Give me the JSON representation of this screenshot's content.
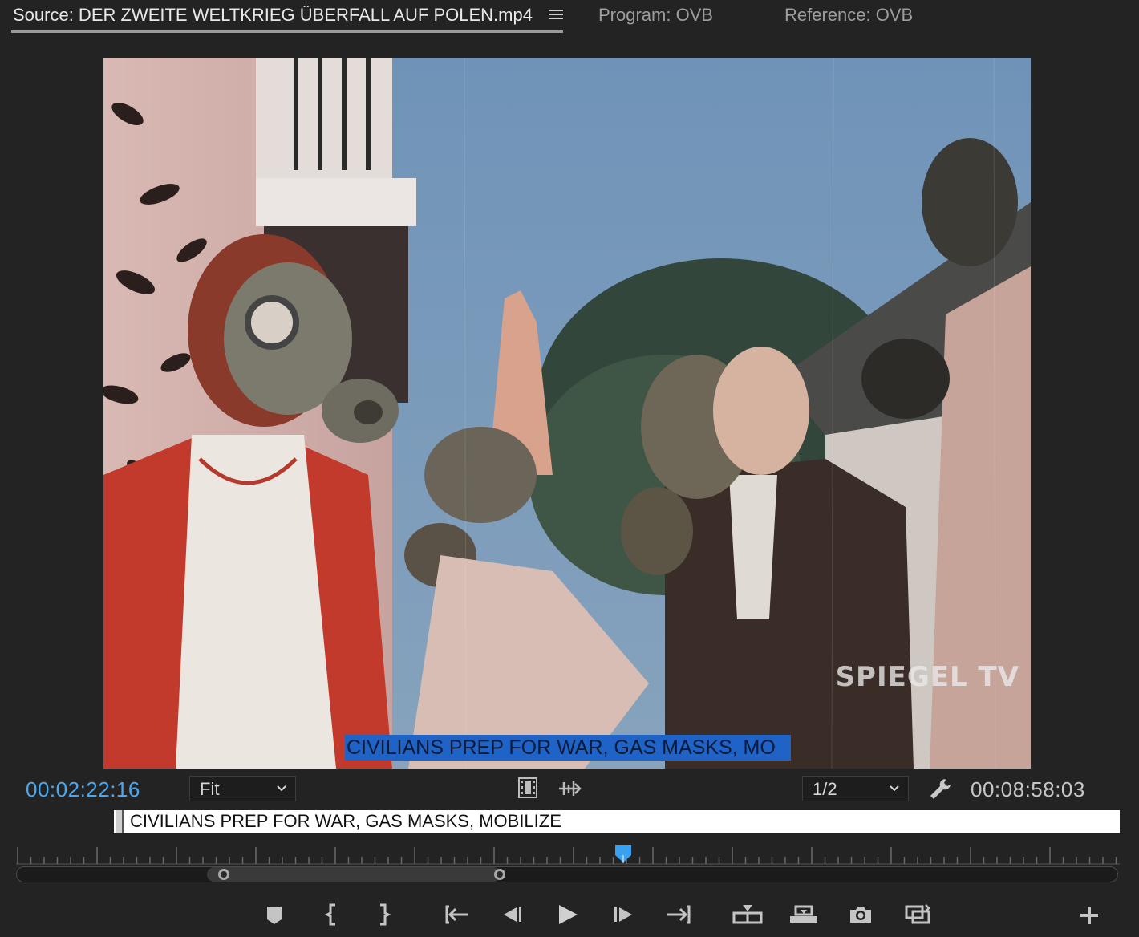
{
  "tabs": {
    "source": "Source: DER ZWEITE WELTKRIEG ÜBERFALL AUF POLEN.mp4",
    "program": "Program: OVB",
    "reference": "Reference: OVB"
  },
  "viewer": {
    "watermark": "SPIEGEL TV",
    "caption_overlay": "CIVILIANS PREP FOR WAR, GAS MASKS, MO"
  },
  "controls": {
    "current_timecode": "00:02:22:16",
    "zoom_level": "Fit",
    "playback_resolution": "1/2",
    "duration_timecode": "00:08:58:03"
  },
  "caption_editor": {
    "value": "CIVILIANS PREP FOR WAR, GAS MASKS, MOBILIZE"
  },
  "timeline": {
    "playhead_fraction": 0.55,
    "visible_range_fraction": [
      0.187,
      0.44
    ]
  },
  "colors": {
    "accent": "#4aa8f0",
    "caption_highlight": "#1f63c6",
    "panel_bg": "#232323"
  },
  "icons": {
    "settings": "wrench-icon",
    "export_frame": "camera-icon",
    "add_button": "plus-icon"
  }
}
